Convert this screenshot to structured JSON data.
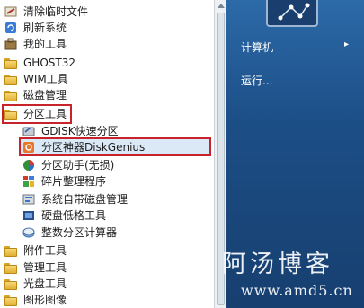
{
  "menu_items": [
    {
      "label": "清除临时文件",
      "icon": "broom-icon"
    },
    {
      "label": "刷新系统",
      "icon": "refresh-icon"
    },
    {
      "label": "我的工具",
      "icon": "tools-icon"
    },
    {
      "label": "GHOST32",
      "icon": "folder-icon"
    },
    {
      "label": "WIM工具",
      "icon": "folder-icon"
    },
    {
      "label": "磁盘管理",
      "icon": "folder-icon"
    },
    {
      "label": "分区工具",
      "icon": "folder-icon"
    },
    {
      "label": "GDISK快速分区",
      "icon": "gdisk-icon"
    },
    {
      "label": "分区神器DiskGenius",
      "icon": "diskgenius-icon"
    },
    {
      "label": "分区助手(无损)",
      "icon": "partition-assistant-icon"
    },
    {
      "label": "碎片整理程序",
      "icon": "defrag-icon"
    },
    {
      "label": "系统自带磁盘管理",
      "icon": "disk-management-icon"
    },
    {
      "label": "硬盘低格工具",
      "icon": "lowformat-icon"
    },
    {
      "label": "整数分区计算器",
      "icon": "calculator-icon"
    },
    {
      "label": "附件工具",
      "icon": "folder-icon"
    },
    {
      "label": "管理工具",
      "icon": "folder-icon"
    },
    {
      "label": "光盘工具",
      "icon": "folder-icon"
    },
    {
      "label": "图形图像",
      "icon": "folder-icon"
    }
  ],
  "right_panel": {
    "computer_label": "计算机",
    "run_label": "运行...",
    "computer_arrow": "▸"
  },
  "watermark": {
    "line1": "阿汤博客",
    "line2": "www.amd5.cn"
  },
  "colors": {
    "highlight_border": "#c8232b",
    "panel_blue": "#1c4e86"
  }
}
